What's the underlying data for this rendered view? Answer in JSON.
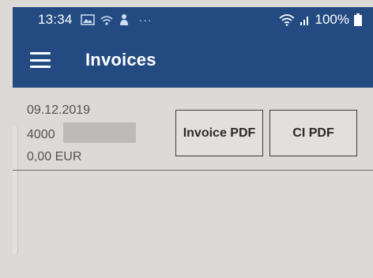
{
  "status_bar": {
    "time": "13:34",
    "icons": [
      "gallery-icon",
      "fairy-wifi-icon",
      "person-icon"
    ],
    "more": "···",
    "battery": "100%"
  },
  "app_bar": {
    "title": "Invoices"
  },
  "invoice": {
    "date": "09.12.2019",
    "number_prefix": "4000",
    "amount": "0,00 EUR",
    "invoice_pdf_label": "Invoice PDF",
    "ci_pdf_label": "CI PDF"
  },
  "colors": {
    "header_bg": "#234b82",
    "page_bg": "#ddd9d6",
    "button_border": "#3c3a39"
  }
}
